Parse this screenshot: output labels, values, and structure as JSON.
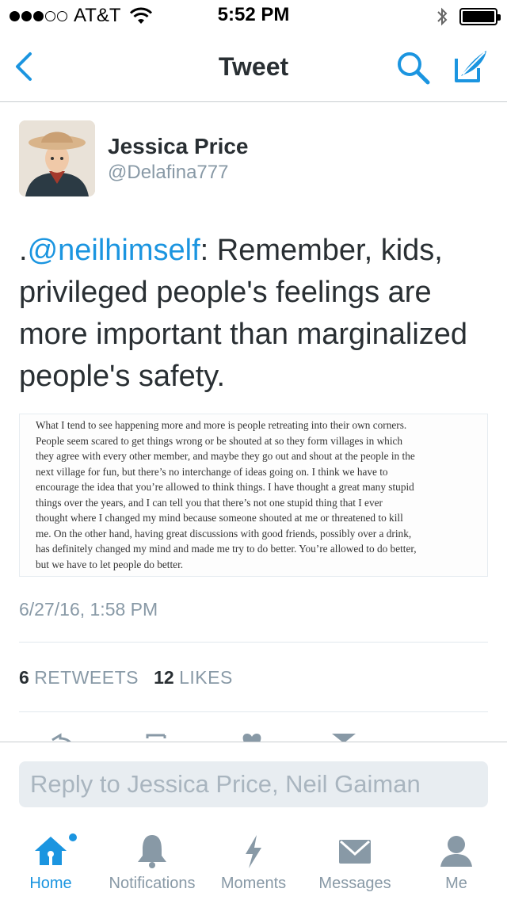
{
  "status_bar": {
    "carrier": "AT&T",
    "time": "5:52 PM",
    "signal_bars_filled": 3,
    "signal_bars_total": 5,
    "battery_level": 1.0
  },
  "nav": {
    "title": "Tweet",
    "back_icon": "chevron-left-icon",
    "search_icon": "search-icon",
    "compose_icon": "compose-icon"
  },
  "tweet": {
    "author_name": "Jessica Price",
    "author_handle": "@Delafina777",
    "text_prefix": ".",
    "mention": "@neilhimself",
    "text_body": ": Remember, kids, privileged people's feelings are more important than marginalized people's safety.",
    "media_text": "What I tend to see happening more and more is people retreating into their own corners.\nPeople seem scared to get things wrong or be shouted at so they form villages in which\nthey agree with every other member, and maybe they go out and shout at the people in the\nnext village for fun, but there’s no interchange of ideas going on. I think we have to\nencourage the idea that you’re allowed to think things. I have thought a great many stupid\nthings over the years, and I can tell you that there’s not one stupid thing that I ever\nthought where I changed my mind because someone shouted at me or threatened to kill\nme. On the other hand, having great discussions with good friends, possibly over a drink,\nhas definitely changed my mind and made me try to do better. You’re allowed to do better,\nbut we have to let people do better.",
    "timestamp": "6/27/16, 1:58 PM",
    "retweets_count": "6",
    "retweets_label": "RETWEETS",
    "likes_count": "12",
    "likes_label": "LIKES"
  },
  "reply": {
    "placeholder": "Reply to Jessica Price, Neil Gaiman"
  },
  "tabs": [
    {
      "label": "Home",
      "icon": "home-icon",
      "active": true
    },
    {
      "label": "Notifications",
      "icon": "bell-icon",
      "active": false
    },
    {
      "label": "Moments",
      "icon": "lightning-icon",
      "active": false
    },
    {
      "label": "Messages",
      "icon": "envelope-icon",
      "active": false
    },
    {
      "label": "Me",
      "icon": "person-icon",
      "active": false
    }
  ],
  "colors": {
    "accent": "#1b95e0",
    "text": "#292f33",
    "secondary": "#8899a6",
    "divider": "#e1e8ed"
  }
}
